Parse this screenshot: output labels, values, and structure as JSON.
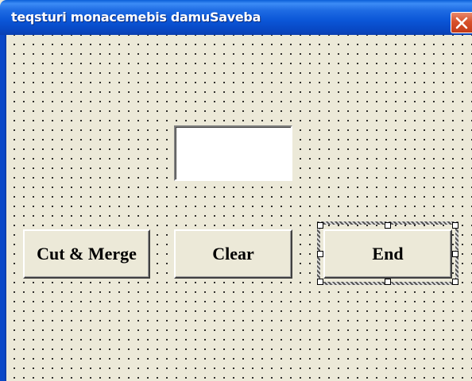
{
  "window": {
    "title": "teqsturi monacemebis damuSaveba"
  },
  "icons": {
    "close": "close-icon"
  },
  "buttons": {
    "cut_merge": "Cut & Merge",
    "clear": "Clear",
    "end": "End"
  },
  "textbox": {
    "value": ""
  },
  "colors": {
    "titlebar": "#0A55D6",
    "close_button": "#D8512B",
    "form_background": "#ECE9D8"
  }
}
